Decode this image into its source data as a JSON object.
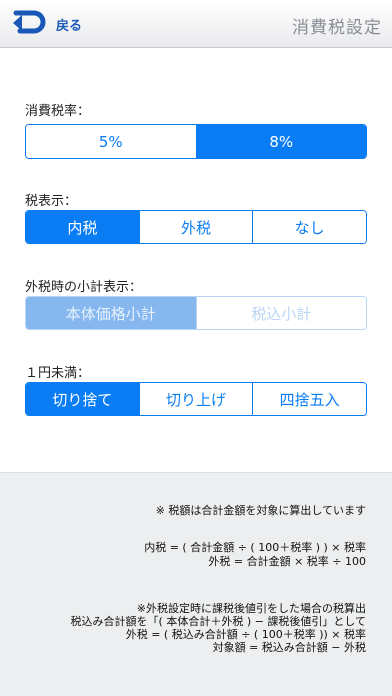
{
  "nav": {
    "back_label": "戻る",
    "title": "消費税設定"
  },
  "tax_rate": {
    "label": "消費税率：",
    "options": [
      "5%",
      "8%"
    ],
    "selected": "8%"
  },
  "tax_display": {
    "label": "税表示：",
    "options": [
      "内税",
      "外税",
      "なし"
    ],
    "selected": "内税"
  },
  "subtotal_display": {
    "label": "外税時の小計表示：",
    "options": [
      "本体価格小計",
      "税込小計"
    ],
    "selected": "本体価格小計",
    "enabled": false
  },
  "rounding": {
    "label": "１円未満：",
    "options": [
      "切り捨て",
      "切り上げ",
      "四捨五入"
    ],
    "selected": "切り捨て"
  },
  "notes": {
    "line1": "※ 税額は合計金額を対象に算出しています",
    "line2": "内税 = ( 合計金額 ÷ ( 100＋税率 ) ) × 税率",
    "line3": "外税 = 合計金額 × 税率 ÷ 100",
    "line4": "※外税設定時に課税後値引をした場合の税算出",
    "line5": "税込み合計額を「( 本体合計＋外税 ) − 課税後値引」として",
    "line6": "外税 = ( 税込み合計額 ÷ ( 100＋税率 )) × 税率",
    "line7": "対象額 = 税込み合計額 − 外税"
  },
  "colors": {
    "accent": "#0a7df5",
    "accent_disabled": "#86b8ef",
    "nav_text": "#1a58b8",
    "notes_bg": "#eceeef"
  }
}
